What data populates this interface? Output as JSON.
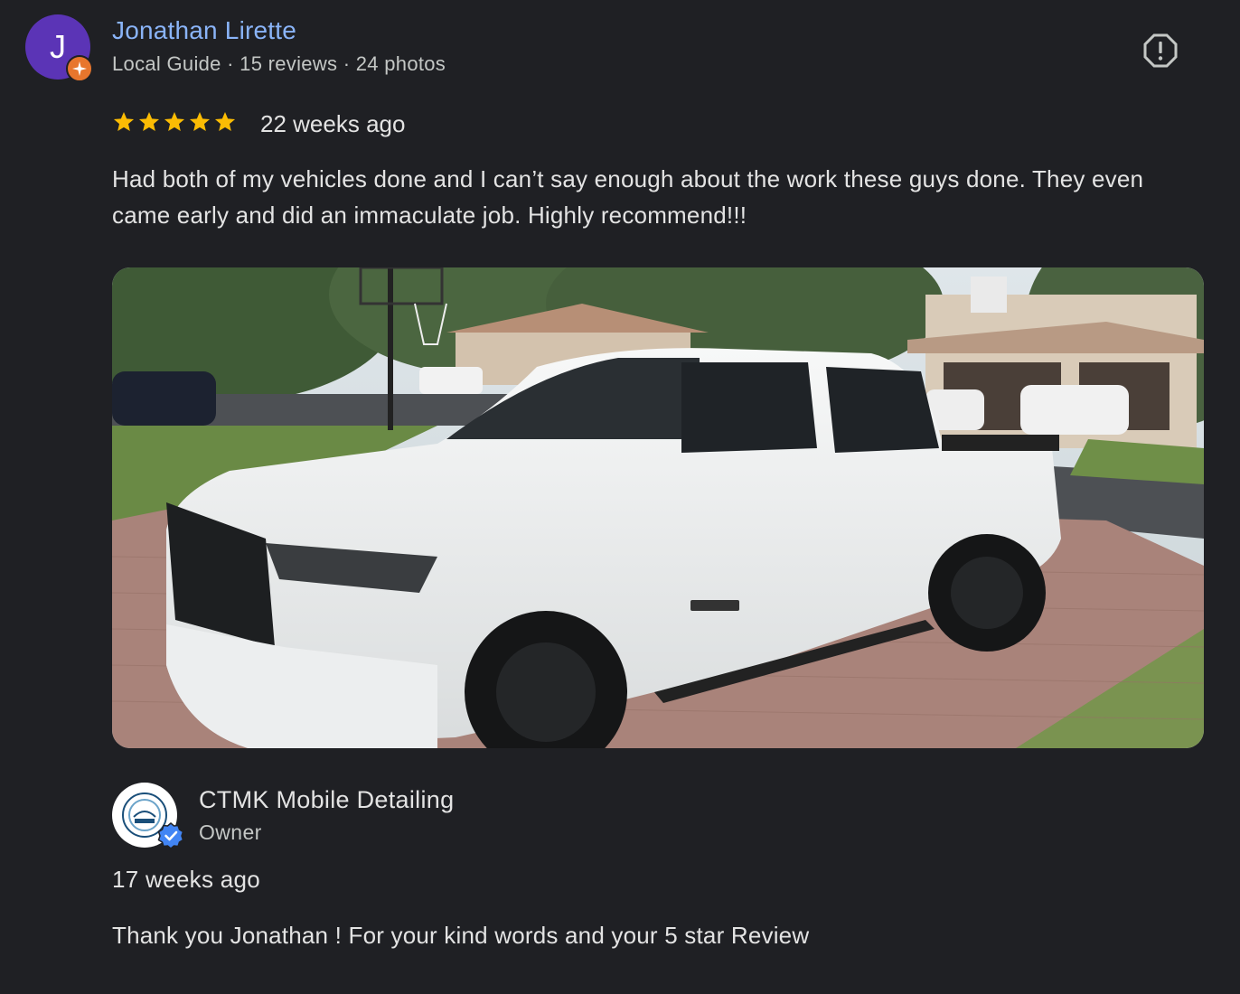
{
  "reviewer": {
    "initial": "J",
    "name": "Jonathan Lirette",
    "meta": "Local Guide · 15 reviews · 24 photos",
    "avatar_color": "#5b34b6",
    "badge_color": "#e8762d"
  },
  "review": {
    "rating": 5,
    "time": "22 weeks ago",
    "text": "Had both of my vehicles done and I can’t say enough about the work these guys done. They even came early and did an immaculate job. Highly recommend!!!",
    "star_color": "#fbbc04",
    "photo_subject": "white pickup truck parked on brick driveway"
  },
  "owner_reply": {
    "name": "CTMK Mobile Detailing",
    "role": "Owner",
    "time": "17 weeks ago",
    "text": "Thank you Jonathan ! For your kind words and your 5 star Review",
    "verified_color": "#4285f4"
  },
  "icons": {
    "report": "report-flag-icon",
    "verified": "verified-check-icon",
    "local_guide": "local-guide-star-icon"
  }
}
